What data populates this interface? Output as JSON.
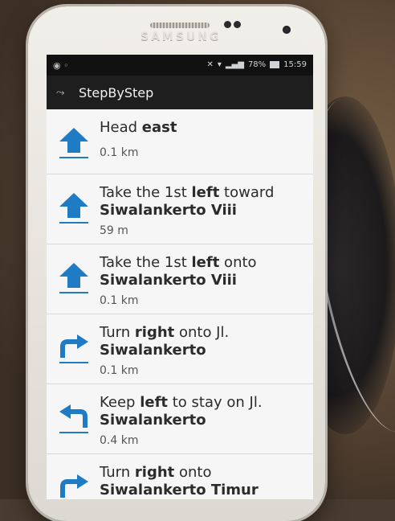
{
  "device": {
    "brand": "SAMSUNG",
    "status": {
      "battery_percent": "78%",
      "time": "15:59"
    }
  },
  "app": {
    "title": "StepByStep"
  },
  "steps": [
    {
      "icon": "arrow-up-icon",
      "instruction_prefix": "Head ",
      "instruction_bold": "east",
      "instruction_suffix": "",
      "street": "",
      "distance": "0.1 km"
    },
    {
      "icon": "arrow-up-icon",
      "instruction_prefix": "Take the 1st ",
      "instruction_bold": "left",
      "instruction_suffix": " toward",
      "street": "Siwalankerto Viii",
      "distance": "59 m"
    },
    {
      "icon": "arrow-up-icon",
      "instruction_prefix": "Take the 1st ",
      "instruction_bold": "left",
      "instruction_suffix": " onto",
      "street": "Siwalankerto Viii",
      "distance": "0.1 km"
    },
    {
      "icon": "turn-right-icon",
      "instruction_prefix": "Turn ",
      "instruction_bold": "right",
      "instruction_suffix": " onto Jl.",
      "street": "Siwalankerto",
      "distance": "0.1 km"
    },
    {
      "icon": "keep-left-icon",
      "instruction_prefix": "Keep ",
      "instruction_bold": "left",
      "instruction_suffix": " to stay on Jl.",
      "street": "Siwalankerto",
      "distance": "0.4 km"
    },
    {
      "icon": "turn-right-icon",
      "instruction_prefix": "Turn ",
      "instruction_bold": "right",
      "instruction_suffix": " onto",
      "street": "Siwalankerto Timur",
      "distance": ""
    }
  ],
  "colors": {
    "icon_blue": "#1f7cc4",
    "bar_dark": "#1e1e1f"
  }
}
